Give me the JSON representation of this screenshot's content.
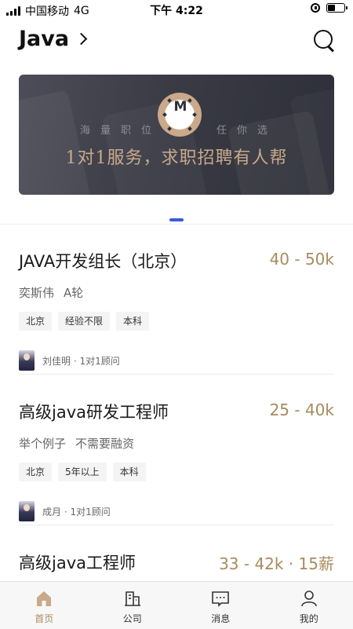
{
  "status_bar": {
    "carrier": "中国移动",
    "network": "4G",
    "time": "下午 4:22",
    "battery_level": 0.45
  },
  "header": {
    "city": "Java"
  },
  "banner": {
    "logo_text": "M",
    "slogan_left": "海量职位",
    "slogan_right": "任你选",
    "title": "1对1服务，求职招聘有人帮"
  },
  "jobs": [
    {
      "title": "JAVA开发组长（北京）",
      "salary": "40 - 50k",
      "company": "奕斯伟",
      "stage": "A轮",
      "tags": [
        "北京",
        "经验不限",
        "本科"
      ],
      "recruiter": "刘佳明 · 1对1顾问"
    },
    {
      "title": "高级java研发工程师",
      "salary": "25 - 40k",
      "company": "举个例子",
      "stage": "不需要融资",
      "tags": [
        "北京",
        "5年以上",
        "本科"
      ],
      "recruiter": "成月 · 1对1顾问"
    },
    {
      "title": "高级java工程师",
      "salary": "33 - 42k · 15薪"
    }
  ],
  "tabbar": {
    "items": [
      {
        "label": "首页",
        "icon": "home-icon",
        "active": true
      },
      {
        "label": "公司",
        "icon": "company-icon"
      },
      {
        "label": "消息",
        "icon": "message-icon"
      },
      {
        "label": "我的",
        "icon": "profile-icon"
      }
    ],
    "accent": "#a88b5c"
  },
  "colors": {
    "salary": "#a88b5c",
    "pager_active": "#3b5bdb",
    "banner_bg": "#3a3b45"
  }
}
